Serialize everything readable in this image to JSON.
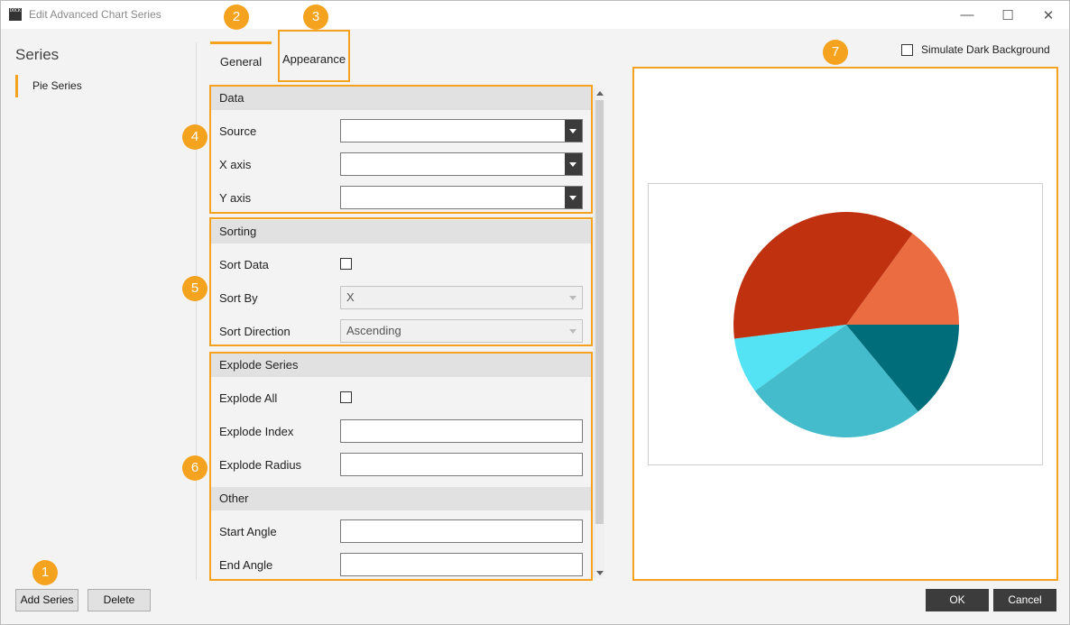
{
  "window": {
    "title": "Edit Advanced Chart Series",
    "app_icon_text": "DOCK",
    "minimize_glyph": "—",
    "maximize_glyph": "☐",
    "close_glyph": "✕"
  },
  "sidebar": {
    "heading": "Series",
    "items": [
      {
        "label": "Pie Series",
        "selected": true
      }
    ]
  },
  "tabs": [
    {
      "label": "General",
      "active": true
    },
    {
      "label": "Appearance",
      "active": false
    }
  ],
  "sections": {
    "data": {
      "header": "Data",
      "source_label": "Source",
      "source_value": "",
      "x_axis_label": "X axis",
      "x_axis_value": "",
      "y_axis_label": "Y axis",
      "y_axis_value": ""
    },
    "sorting": {
      "header": "Sorting",
      "sort_data_label": "Sort Data",
      "sort_data_checked": false,
      "sort_by_label": "Sort By",
      "sort_by_value": "X",
      "sort_direction_label": "Sort Direction",
      "sort_direction_value": "Ascending"
    },
    "explode": {
      "header": "Explode Series",
      "explode_all_label": "Explode All",
      "explode_all_checked": false,
      "explode_index_label": "Explode Index",
      "explode_index_value": "",
      "explode_radius_label": "Explode Radius",
      "explode_radius_value": ""
    },
    "other": {
      "header": "Other",
      "start_angle_label": "Start Angle",
      "start_angle_value": "",
      "end_angle_label": "End Angle",
      "end_angle_value": ""
    }
  },
  "preview": {
    "simulate_dark_label": "Simulate Dark Background",
    "simulate_dark_checked": false
  },
  "callouts": [
    "1",
    "2",
    "3",
    "4",
    "5",
    "6",
    "7"
  ],
  "buttons": {
    "add_series": "Add Series",
    "delete": "Delete",
    "ok": "OK",
    "cancel": "Cancel"
  },
  "colors": {
    "accent": "#f5a21e",
    "dark_button": "#3c3c3c"
  },
  "chart_data": {
    "type": "pie",
    "values": [
      15,
      37,
      8,
      26,
      14
    ],
    "colors": [
      "#ec6c41",
      "#c03110",
      "#54e3f5",
      "#45bccb",
      "#006d7a"
    ],
    "start_angle_deg": 0,
    "direction": "counterclockwise"
  }
}
